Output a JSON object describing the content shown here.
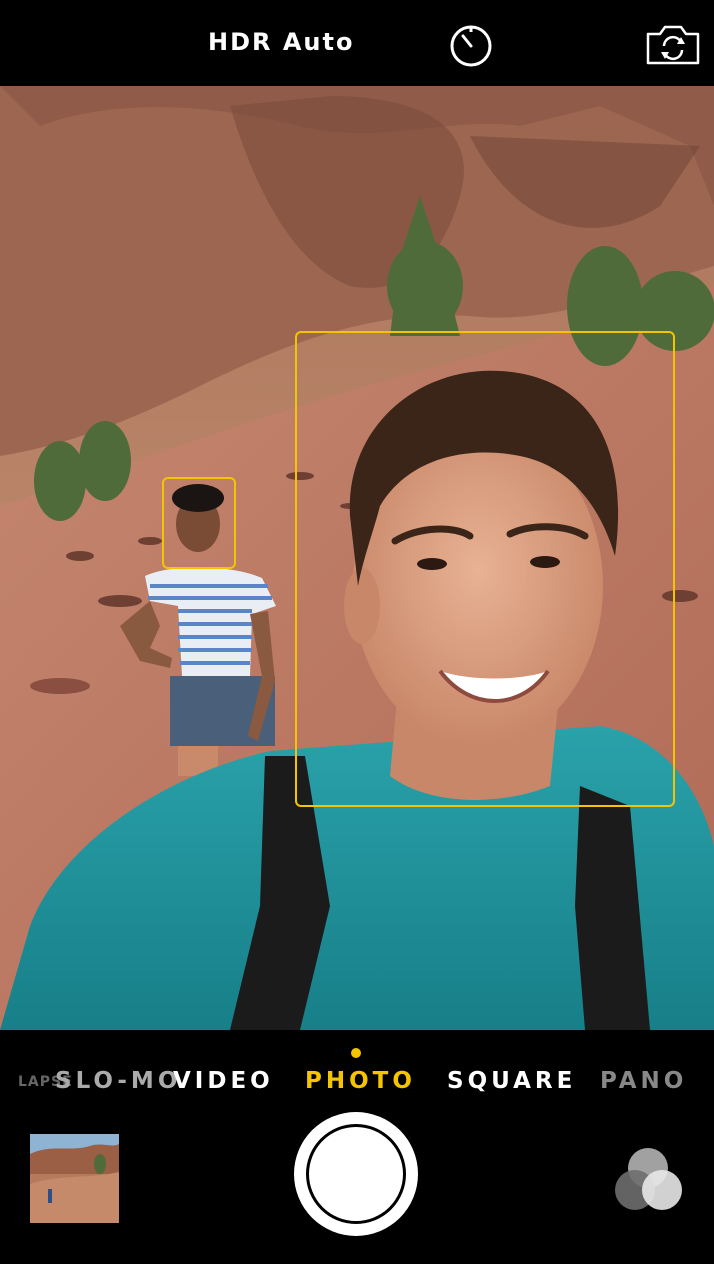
{
  "topbar": {
    "hdr_label": "HDR Auto",
    "timer_icon": "timer-icon",
    "flip_icon": "camera-flip-icon"
  },
  "viewfinder": {
    "focus_color": "#f5c400"
  },
  "modes": {
    "lapse": "LAPSE",
    "slomo": "SLO-MO",
    "video": "VIDEO",
    "photo": "PHOTO",
    "square": "SQUARE",
    "pano": "PANO",
    "selected": "PHOTO"
  },
  "controls": {
    "shutter_icon": "shutter-button",
    "filters_icon": "filters-icon",
    "thumbnail_icon": "last-photo-thumbnail"
  }
}
